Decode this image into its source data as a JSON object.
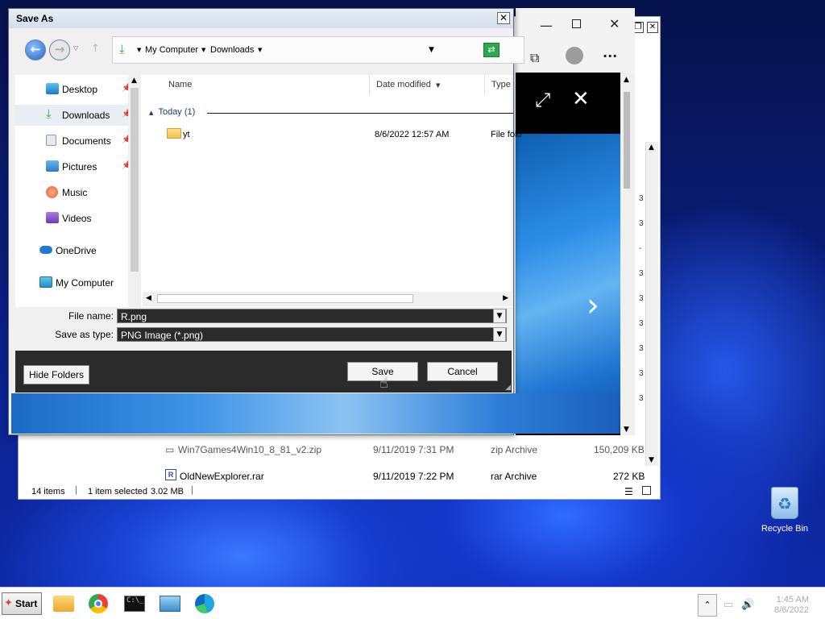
{
  "desktop": {
    "recycle_bin_label": "Recycle Bin"
  },
  "explorer": {
    "rows": [
      {
        "name": "Win7Games4Win10_8_81_v2.zip",
        "date": "9/11/2019 7:31 PM",
        "type": "zip Archive",
        "size": "150,209 KB"
      },
      {
        "name": "OldNewExplorer.rar",
        "date": "9/11/2019 7:22 PM",
        "type": "rar Archive",
        "size": "272 KB"
      }
    ],
    "status": {
      "items": "14 items",
      "selected": "1 item selected",
      "size": "3.02 MB"
    }
  },
  "dialog": {
    "title": "Save As",
    "breadcrumb": [
      "My Computer",
      "Downloads"
    ],
    "sidebar": [
      {
        "label": "Desktop",
        "icon": "desktop-icon",
        "pinned": true
      },
      {
        "label": "Downloads",
        "icon": "downloads-icon",
        "pinned": true,
        "selected": true
      },
      {
        "label": "Documents",
        "icon": "documents-icon",
        "pinned": true
      },
      {
        "label": "Pictures",
        "icon": "pictures-icon",
        "pinned": true
      },
      {
        "label": "Music",
        "icon": "music-icon",
        "pinned": false
      },
      {
        "label": "Videos",
        "icon": "videos-icon",
        "pinned": false
      },
      {
        "label": "OneDrive",
        "icon": "onedrive-icon",
        "pinned": false
      },
      {
        "label": "My Computer",
        "icon": "computer-icon",
        "pinned": false
      }
    ],
    "columns": {
      "name": "Name",
      "date": "Date modified",
      "type": "Type"
    },
    "group": "Today (1)",
    "files": [
      {
        "name": "yt",
        "date": "8/6/2022 12:57 AM",
        "type": "File fold"
      }
    ],
    "filename_label": "File name:",
    "filename_value": "R.png",
    "type_label": "Save as type:",
    "type_value": "PNG Image (*.png)",
    "hide_folders": "Hide Folders",
    "save": "Save",
    "cancel": "Cancel"
  },
  "taskbar": {
    "start": "Start",
    "time": "1:45 AM",
    "date": "8/6/2022"
  },
  "colors": {
    "accent_green": "#2ea84a",
    "dialog_bg": "#f0f0f0",
    "dark_panel": "#2b2b2b",
    "wallpaper": "#0b2290"
  }
}
